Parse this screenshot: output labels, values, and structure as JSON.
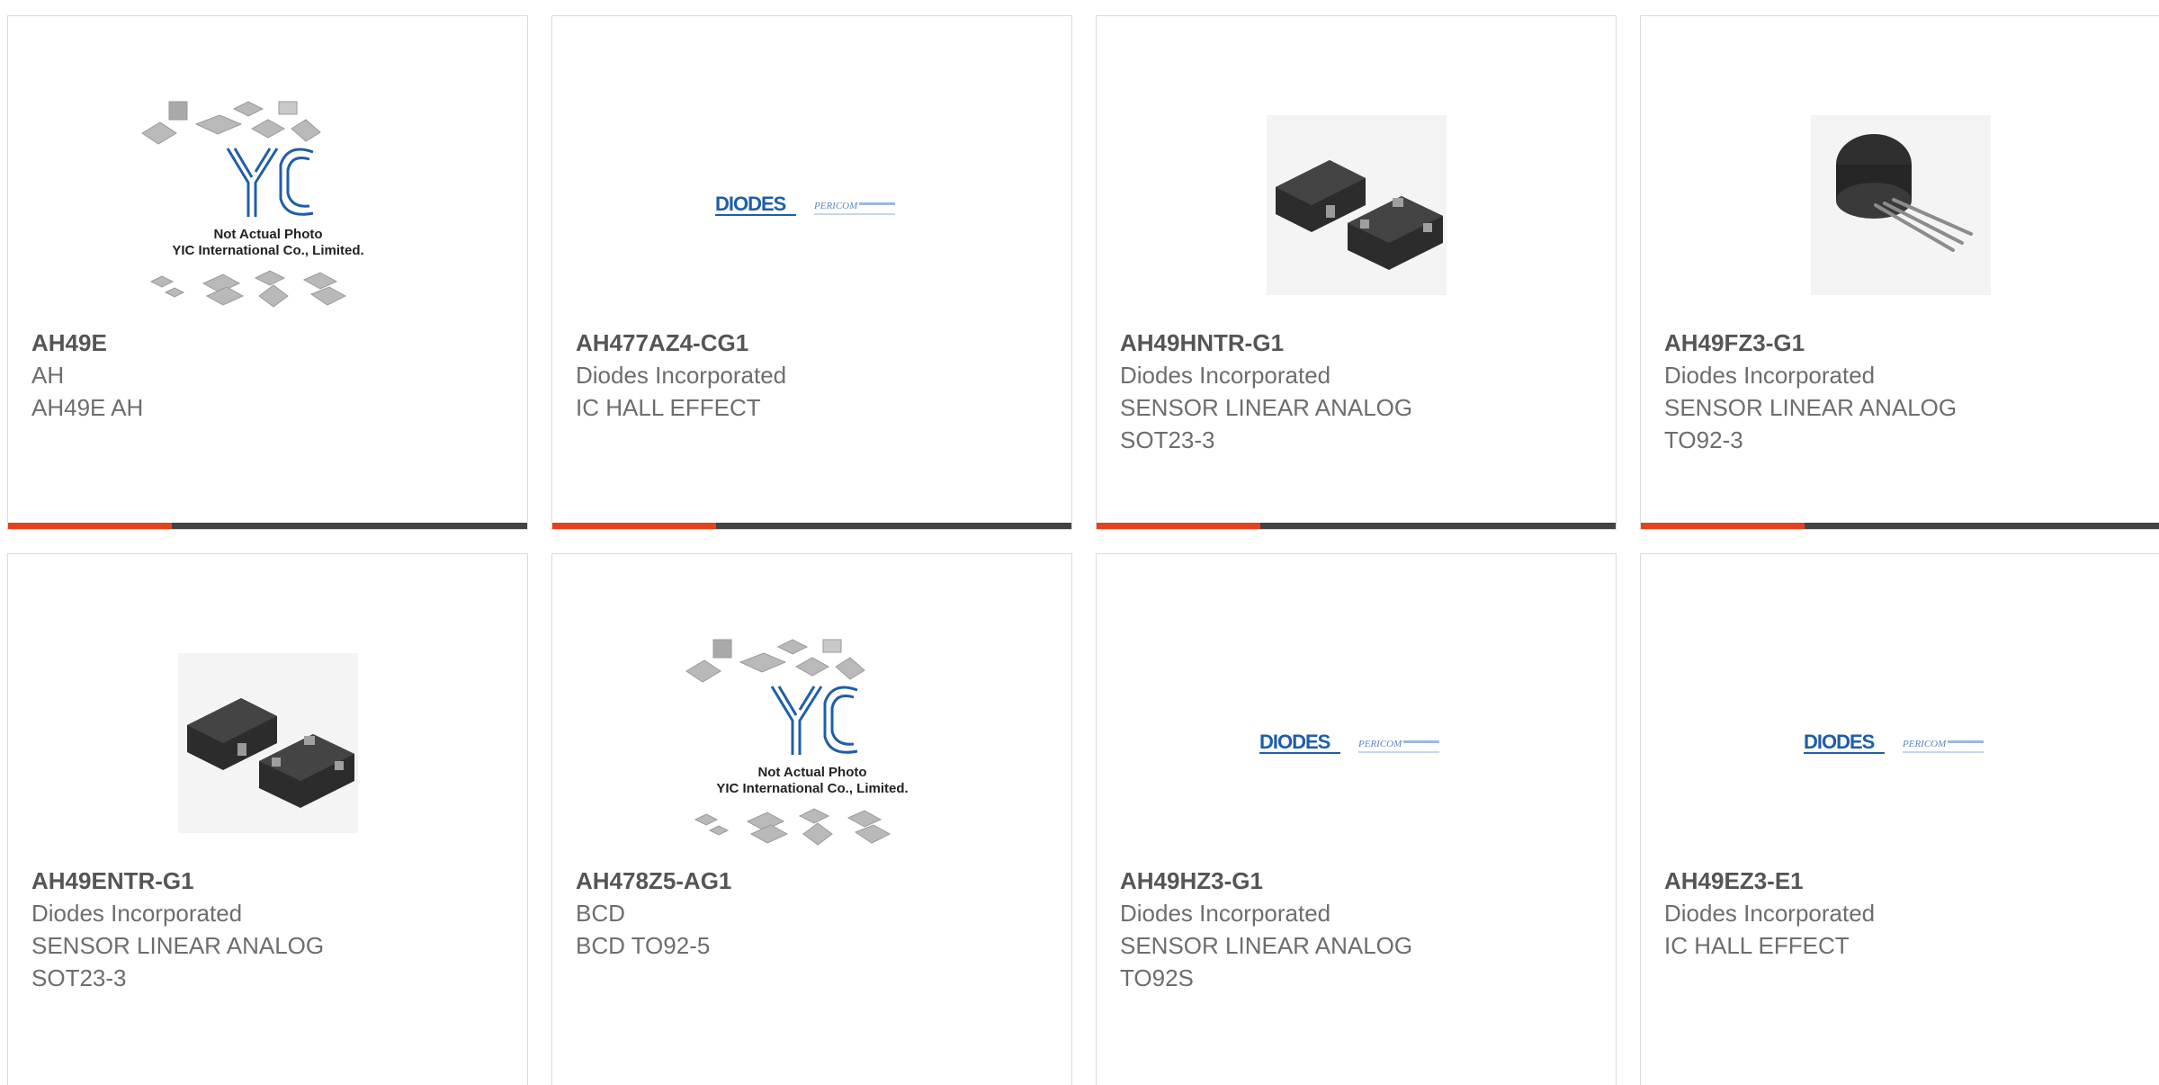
{
  "colors": {
    "accent": "#e2431e",
    "bar_dark": "#434343",
    "title_text": "#555555",
    "body_text": "#6d6d6d",
    "diodes_blue": "#1f5ea8"
  },
  "placeholder_image": {
    "caption_line1": "Not Actual Photo",
    "caption_line2": "YIC International Co., Limited."
  },
  "brand_logo": {
    "brand": "DIODES",
    "sub": "PERICOM"
  },
  "products": [
    {
      "part": "AH49E",
      "line1": "AH",
      "line2": "AH49E AH",
      "line3": "",
      "image": "yic-placeholder"
    },
    {
      "part": "AH477AZ4-CG1",
      "line1": "Diodes Incorporated",
      "line2": "IC HALL EFFECT",
      "line3": "",
      "image": "diodes-logo"
    },
    {
      "part": "AH49HNTR-G1",
      "line1": "Diodes Incorporated",
      "line2": "SENSOR LINEAR ANALOG",
      "line3": "SOT23-3",
      "image": "sot23-package"
    },
    {
      "part": "AH49FZ3-G1",
      "line1": "Diodes Incorporated",
      "line2": "SENSOR LINEAR ANALOG",
      "line3": "TO92-3",
      "image": "to92-package"
    },
    {
      "part": "AH49ENTR-G1",
      "line1": "Diodes Incorporated",
      "line2": "SENSOR LINEAR ANALOG",
      "line3": "SOT23-3",
      "image": "sot23-package"
    },
    {
      "part": "AH478Z5-AG1",
      "line1": "BCD",
      "line2": "BCD TO92-5",
      "line3": "",
      "image": "yic-placeholder"
    },
    {
      "part": "AH49HZ3-G1",
      "line1": "Diodes Incorporated",
      "line2": "SENSOR LINEAR ANALOG",
      "line3": "TO92S",
      "image": "diodes-logo"
    },
    {
      "part": "AH49EZ3-E1",
      "line1": "Diodes Incorporated",
      "line2": "IC HALL EFFECT",
      "line3": "",
      "image": "diodes-logo"
    }
  ]
}
